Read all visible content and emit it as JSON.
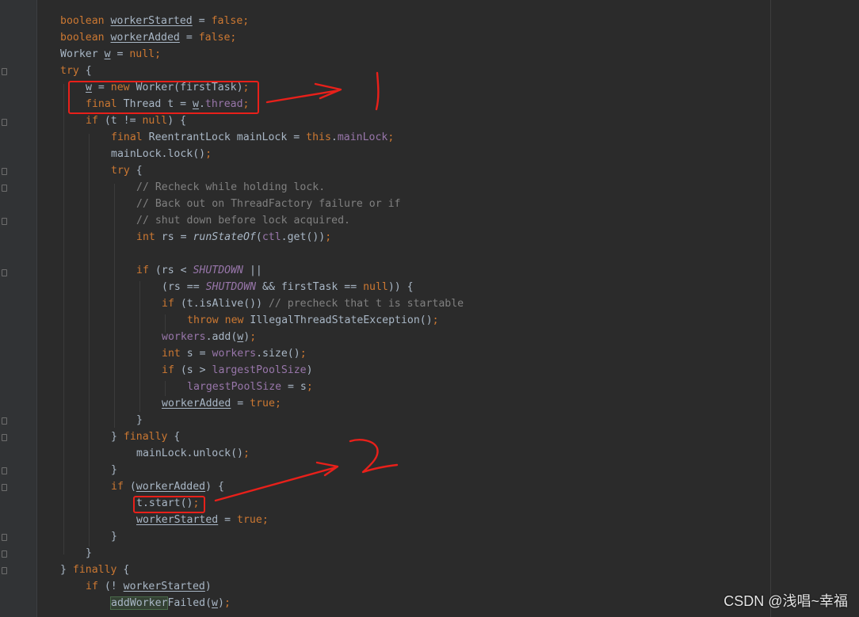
{
  "editor": {
    "lines": [
      [
        [
          "kw",
          "boolean "
        ],
        [
          "ul",
          "workerStarted"
        ],
        [
          "t",
          " = "
        ],
        [
          "kw",
          "false"
        ],
        [
          "kw",
          ";"
        ]
      ],
      [
        [
          "kw",
          "boolean "
        ],
        [
          "ul",
          "workerAdded"
        ],
        [
          "t",
          " = "
        ],
        [
          "kw",
          "false"
        ],
        [
          "kw",
          ";"
        ]
      ],
      [
        [
          "t",
          "Worker "
        ],
        [
          "ul",
          "w"
        ],
        [
          "t",
          " = "
        ],
        [
          "kw",
          "null"
        ],
        [
          "kw",
          ";"
        ]
      ],
      [
        [
          "kw",
          "try"
        ],
        [
          "t",
          " {"
        ]
      ],
      [
        [
          "ul",
          "w"
        ],
        [
          "t",
          " = "
        ],
        [
          "kw",
          "new "
        ],
        [
          "t",
          "Worker(firstTask)"
        ],
        [
          "kw",
          ";"
        ]
      ],
      [
        [
          "kw",
          "final "
        ],
        [
          "t",
          "Thread t = "
        ],
        [
          "ul",
          "w"
        ],
        [
          "t",
          "."
        ],
        [
          "fld",
          "thread"
        ],
        [
          "kw",
          ";"
        ]
      ],
      [
        [
          "kw",
          "if"
        ],
        [
          "t",
          " (t != "
        ],
        [
          "kw",
          "null"
        ],
        [
          "t",
          ") {"
        ]
      ],
      [
        [
          "kw",
          "final "
        ],
        [
          "t",
          "ReentrantLock mainLock = "
        ],
        [
          "kw",
          "this"
        ],
        [
          "t",
          "."
        ],
        [
          "fld",
          "mainLock"
        ],
        [
          "kw",
          ";"
        ]
      ],
      [
        [
          "t",
          "mainLock.lock()"
        ],
        [
          "kw",
          ";"
        ]
      ],
      [
        [
          "kw",
          "try"
        ],
        [
          "t",
          " {"
        ]
      ],
      [
        [
          "cm",
          "// Recheck while holding lock."
        ]
      ],
      [
        [
          "cm",
          "// Back out on ThreadFactory failure or if"
        ]
      ],
      [
        [
          "cm",
          "// shut down before lock acquired."
        ]
      ],
      [
        [
          "kw",
          "int "
        ],
        [
          "t",
          "rs = "
        ],
        [
          "it",
          "runStateOf"
        ],
        [
          "t",
          "("
        ],
        [
          "fld",
          "ctl"
        ],
        [
          "t",
          ".get())"
        ],
        [
          "kw",
          ";"
        ]
      ],
      [],
      [
        [
          "kw",
          "if"
        ],
        [
          "t",
          " (rs < "
        ],
        [
          "sfld",
          "SHUTDOWN"
        ],
        [
          "t",
          " ||"
        ]
      ],
      [
        [
          "t",
          "(rs == "
        ],
        [
          "sfld",
          "SHUTDOWN"
        ],
        [
          "t",
          " && firstTask == "
        ],
        [
          "kw",
          "null"
        ],
        [
          "t",
          ")) {"
        ]
      ],
      [
        [
          "kw",
          "if"
        ],
        [
          "t",
          " (t.isAlive()) "
        ],
        [
          "cm",
          "// precheck that t is startable"
        ]
      ],
      [
        [
          "kw",
          "throw new "
        ],
        [
          "t",
          "IllegalThreadStateException()"
        ],
        [
          "kw",
          ";"
        ]
      ],
      [
        [
          "fld",
          "workers"
        ],
        [
          "t",
          ".add("
        ],
        [
          "ul",
          "w"
        ],
        [
          "t",
          ")"
        ],
        [
          "kw",
          ";"
        ]
      ],
      [
        [
          "kw",
          "int "
        ],
        [
          "t",
          "s = "
        ],
        [
          "fld",
          "workers"
        ],
        [
          "t",
          ".size()"
        ],
        [
          "kw",
          ";"
        ]
      ],
      [
        [
          "kw",
          "if"
        ],
        [
          "t",
          " (s > "
        ],
        [
          "fld",
          "largestPoolSize"
        ],
        [
          "t",
          ")"
        ]
      ],
      [
        [
          "fld",
          "largestPoolSize"
        ],
        [
          "t",
          " = s"
        ],
        [
          "kw",
          ";"
        ]
      ],
      [
        [
          "ul",
          "workerAdded"
        ],
        [
          "t",
          " = "
        ],
        [
          "kw",
          "true"
        ],
        [
          "kw",
          ";"
        ]
      ],
      [
        [
          "t",
          "}"
        ]
      ],
      [
        [
          "t",
          "} "
        ],
        [
          "kw",
          "finally"
        ],
        [
          "t",
          " {"
        ]
      ],
      [
        [
          "t",
          "mainLock.unlock()"
        ],
        [
          "kw",
          ";"
        ]
      ],
      [
        [
          "t",
          "}"
        ]
      ],
      [
        [
          "kw",
          "if"
        ],
        [
          "t",
          " ("
        ],
        [
          "ul",
          "workerAdded"
        ],
        [
          "t",
          ") {"
        ]
      ],
      [
        [
          "t",
          "t.start()"
        ],
        [
          "kw",
          ";"
        ]
      ],
      [
        [
          "ul",
          "workerStarted"
        ],
        [
          "t",
          " = "
        ],
        [
          "kw",
          "true"
        ],
        [
          "kw",
          ";"
        ]
      ],
      [
        [
          "t",
          "}"
        ]
      ],
      [
        [
          "t",
          "}"
        ]
      ],
      [
        [
          "t",
          "} "
        ],
        [
          "kw",
          "finally"
        ],
        [
          "t",
          " {"
        ]
      ],
      [
        [
          "kw",
          "if"
        ],
        [
          "t",
          " (! "
        ],
        [
          "ul",
          "workerStarted"
        ],
        [
          "t",
          ")"
        ]
      ],
      [
        [
          "hl",
          "addWorker"
        ],
        [
          "t",
          "Failed("
        ],
        [
          "ul",
          "w"
        ],
        [
          "t",
          ")"
        ],
        [
          "kw",
          ";"
        ]
      ]
    ]
  },
  "annotations": {
    "label_1": "1",
    "label_2": "2",
    "color": "#e8201a"
  },
  "watermark": "CSDN @浅唱~幸福"
}
